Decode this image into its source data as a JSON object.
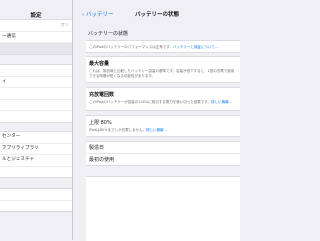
{
  "sidebar": {
    "title": "設定",
    "group1": [
      {
        "label": "",
        "value": "オン"
      },
      {
        "label": "ー通信",
        "value": ""
      },
      {
        "label": "",
        "value": "",
        "selected": true
      }
    ],
    "group2": [
      {
        "label": "",
        "value": ""
      },
      {
        "label": "ィ",
        "value": ""
      },
      {
        "label": "",
        "value": ""
      },
      {
        "label": "",
        "value": ""
      },
      {
        "label": "",
        "value": ""
      }
    ],
    "group3": [
      {
        "label": "センター",
        "value": ""
      },
      {
        "label": "アプリライブラリ",
        "value": ""
      },
      {
        "label": "ルとジェスチャ",
        "value": ""
      },
      {
        "label": "",
        "value": ""
      }
    ],
    "group4": [
      {
        "label": "",
        "value": ""
      },
      {
        "label": "",
        "value": ""
      }
    ]
  },
  "nav": {
    "back_label": "バッテリー",
    "title": "バッテリーの状態"
  },
  "battery_state": {
    "header": "バッテリーの状態",
    "desc_text": "このiPadのバッテリーのパフォーマンスは正常です。",
    "desc_link": "バッテリーと保証について..."
  },
  "max_capacity": {
    "title": "最大容量",
    "desc": "これは、新品時と比較したバッテリー容量の基準です。容量が低下すると、1回の充電で使用できる時間が短くなる可能性があります。"
  },
  "cycle_count": {
    "title": "充放電回数",
    "desc_text": "このiPadのバッテリーが容量の100%に相当する電力を使い切った回数です。",
    "desc_link": "詳しい情報..."
  },
  "limit_80": {
    "title": "上限 80%",
    "desc_text": "iPadは80%までしか充電しません。",
    "desc_link": "詳しい情報..."
  },
  "info_rows": {
    "manufacture_date": "製造日",
    "first_use": "最初の使用"
  },
  "colors": {
    "accent": "#007aff",
    "background": "#efeff4",
    "card": "#ffffff"
  },
  "icons": {
    "back": "chevron-left-icon"
  }
}
